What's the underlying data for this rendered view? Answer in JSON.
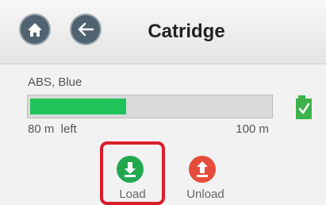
{
  "header": {
    "title": "Catridge",
    "home_icon": "home-icon",
    "back_icon": "back-arrow-icon"
  },
  "filament": {
    "material": "ABS, Blue",
    "remaining_label": "80 m  left",
    "capacity_label": "100 m",
    "fill_fraction": 0.4,
    "status_icon": "cartridge-check-icon"
  },
  "actions": {
    "load_label": "Load",
    "unload_label": "Unload"
  },
  "colors": {
    "icon_button": "#506370",
    "progress_fill": "#1ec45a",
    "load": "#21a84f",
    "unload": "#e54d3a",
    "highlight": "#d81e2c"
  }
}
